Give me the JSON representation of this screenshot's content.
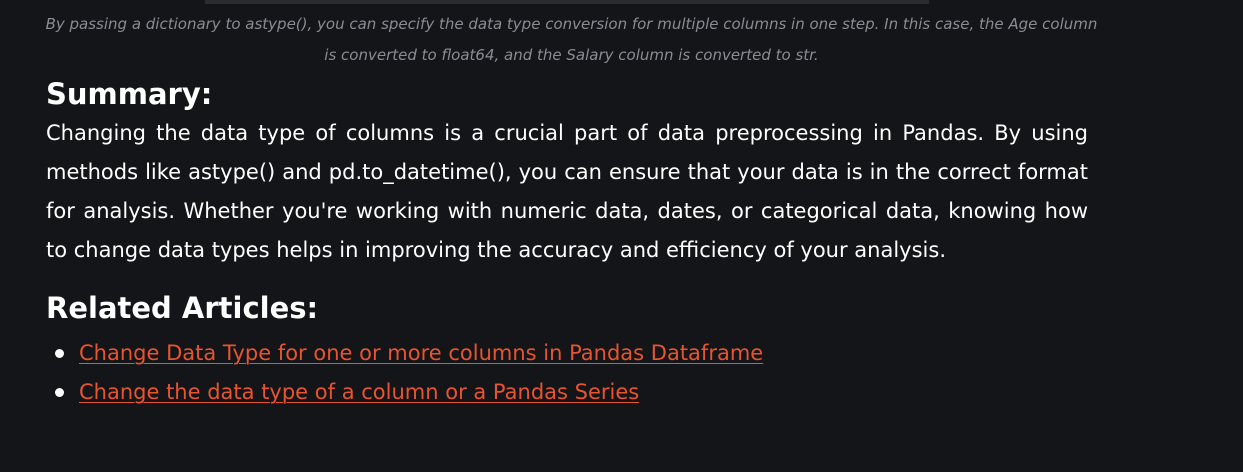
{
  "caption": {
    "line1": "By passing a dictionary to astype(), you can specify the data type conversion for multiple columns in one step. In this case, the Age column",
    "line2": "is converted to float64, and the Salary column is converted to str."
  },
  "summary": {
    "heading": "Summary:",
    "text": "Changing the data type of columns is a crucial part of data preprocessing in Pandas. By using methods like astype() and pd.to_datetime(), you can ensure that your data is in the correct format for analysis. Whether you're working with numeric data, dates, or categorical data, knowing how to change data types helps in improving the accuracy and efficiency of your analysis."
  },
  "related": {
    "heading": "Related Articles:",
    "items": [
      {
        "label": "Change Data Type for one or more columns in Pandas Dataframe"
      },
      {
        "label": "Change the data type of a column or a Pandas Series"
      }
    ]
  },
  "colors": {
    "background": "#141518",
    "text": "#ffffff",
    "caption": "#8a8c92",
    "link": "#e8542e"
  }
}
